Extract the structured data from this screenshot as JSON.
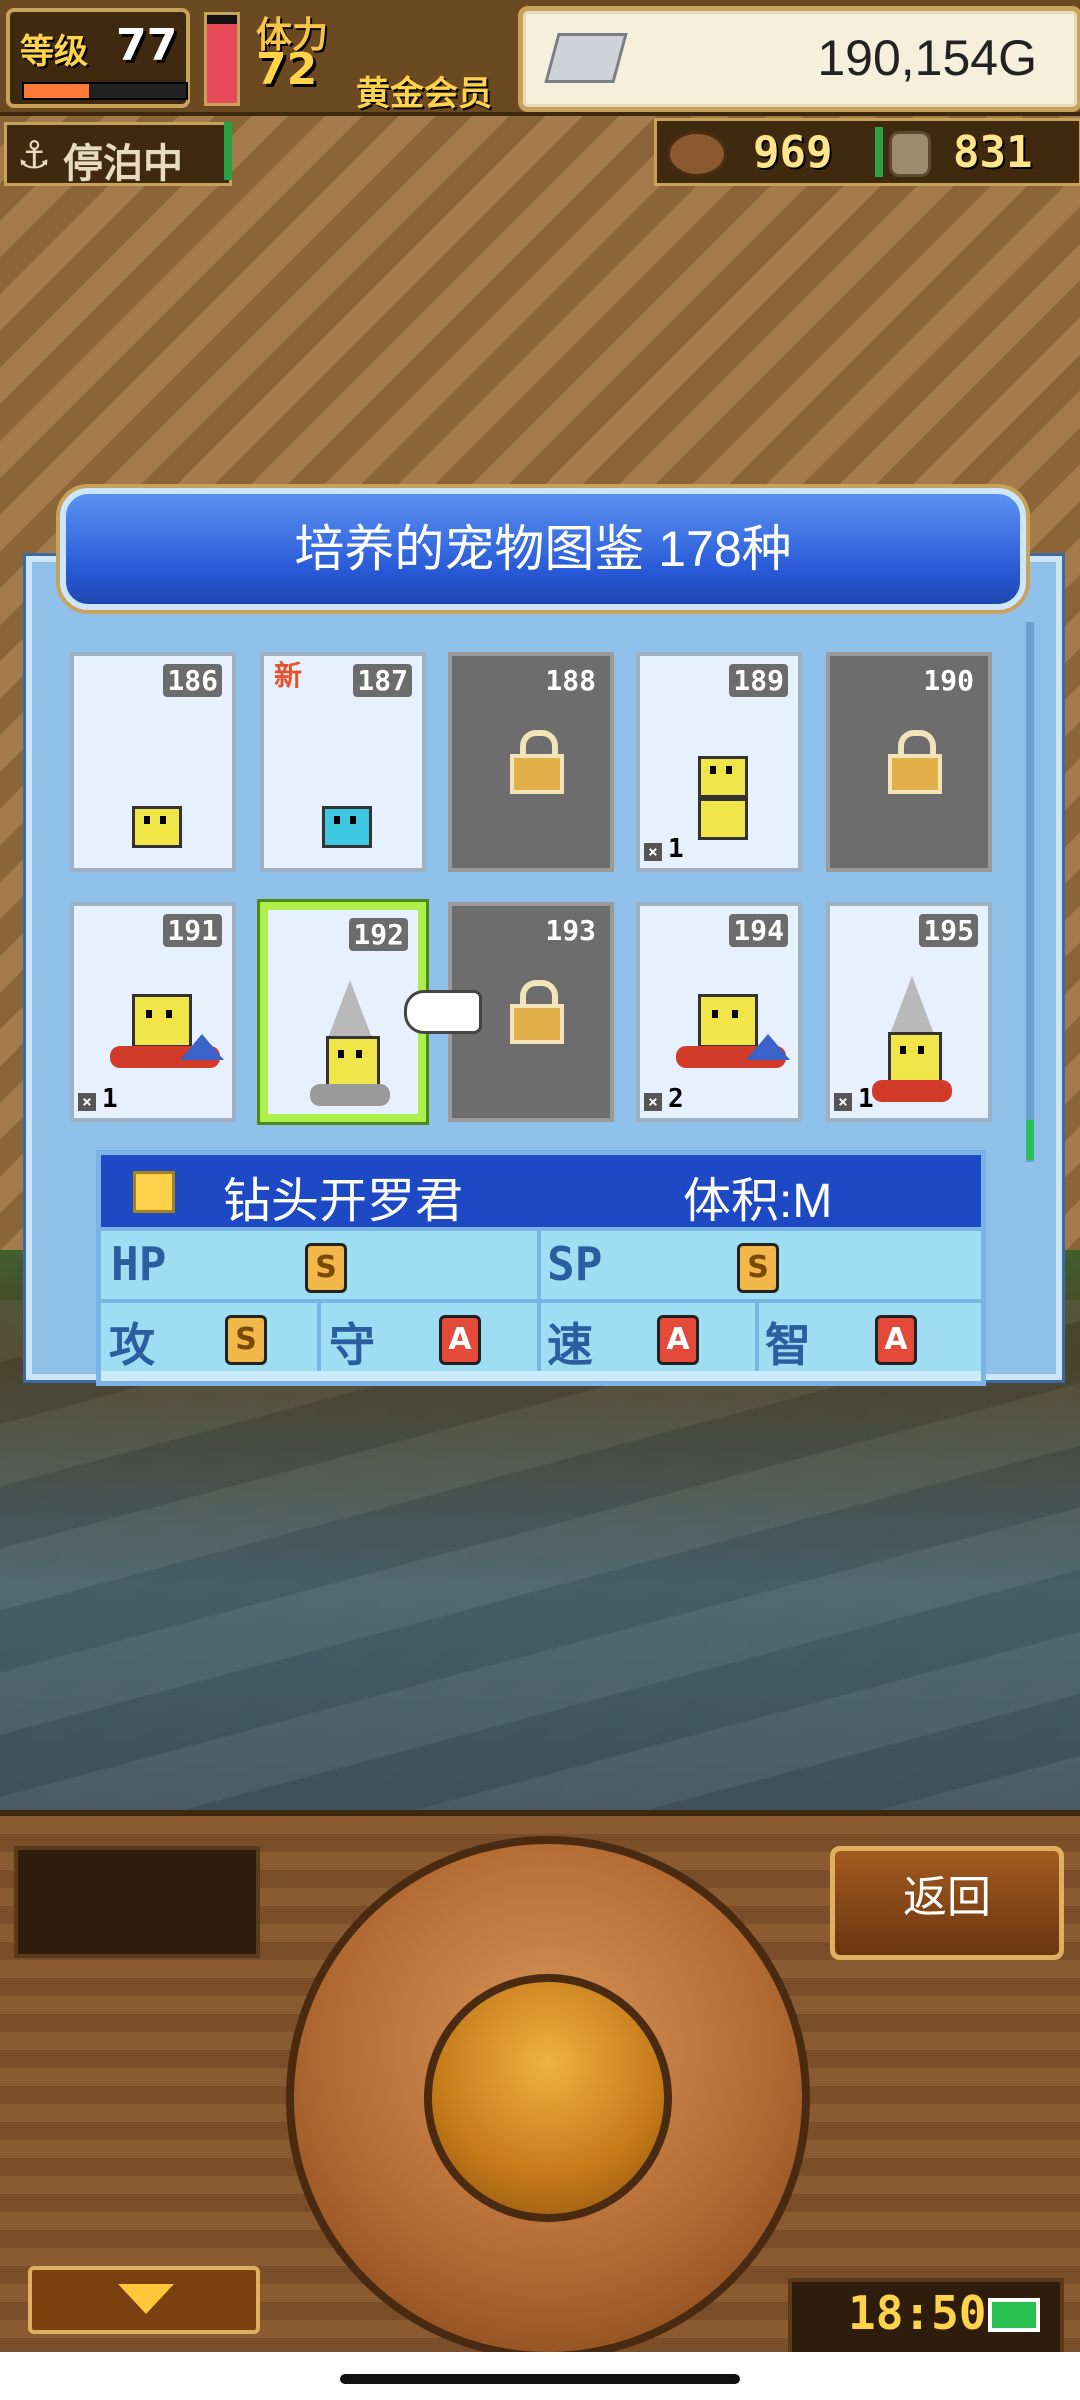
{
  "hud": {
    "level_label": "等级",
    "level_value": "77",
    "xp_fraction": 0.4,
    "stamina_label": "体力",
    "stamina_value": "72",
    "stamina_fraction": 0.9,
    "member_label": "黄金会员",
    "money_value": "190,154G",
    "status_label": "停泊中",
    "resource1_value": "969",
    "resource2_value": "831"
  },
  "dialog": {
    "title": "培养的宠物图鉴  178种",
    "cards": [
      {
        "num": "186",
        "locked": false,
        "new": false,
        "count": null
      },
      {
        "num": "187",
        "locked": false,
        "new": true,
        "new_label": "新",
        "count": null
      },
      {
        "num": "188",
        "locked": true,
        "new": false,
        "count": null
      },
      {
        "num": "189",
        "locked": false,
        "new": false,
        "count": "1"
      },
      {
        "num": "190",
        "locked": true,
        "new": false,
        "count": null
      },
      {
        "num": "191",
        "locked": false,
        "new": false,
        "count": "1"
      },
      {
        "num": "192",
        "locked": false,
        "new": false,
        "count": null,
        "selected": true
      },
      {
        "num": "193",
        "locked": true,
        "new": false,
        "count": null
      },
      {
        "num": "194",
        "locked": false,
        "new": false,
        "count": "2"
      },
      {
        "num": "195",
        "locked": false,
        "new": false,
        "count": "1"
      }
    ],
    "info": {
      "name": "钻头开罗君",
      "size_label": "体积:M",
      "hp_label": "HP",
      "hp_grade": "S",
      "sp_label": "SP",
      "sp_grade": "S",
      "atk_label": "攻",
      "atk_grade": "S",
      "def_label": "守",
      "def_grade": "A",
      "spd_label": "速",
      "spd_grade": "A",
      "int_label": "智",
      "int_grade": "A"
    }
  },
  "controls": {
    "back_label": "返回",
    "clock": "18:50"
  },
  "colors": {
    "title_bar": "#2859d6",
    "panel": "#8fc0ea",
    "selected_border": "#aef04a",
    "locked_card": "#6d6d6d",
    "grade_S": "#f0b84a",
    "grade_A": "#e44a3a"
  },
  "icons": [
    "anchor-icon",
    "silver-bar-icon",
    "bread-icon",
    "coin-icon",
    "padlock-icon",
    "pointing-hand-icon",
    "pet-icon",
    "down-arrow-icon",
    "battery-icon"
  ]
}
